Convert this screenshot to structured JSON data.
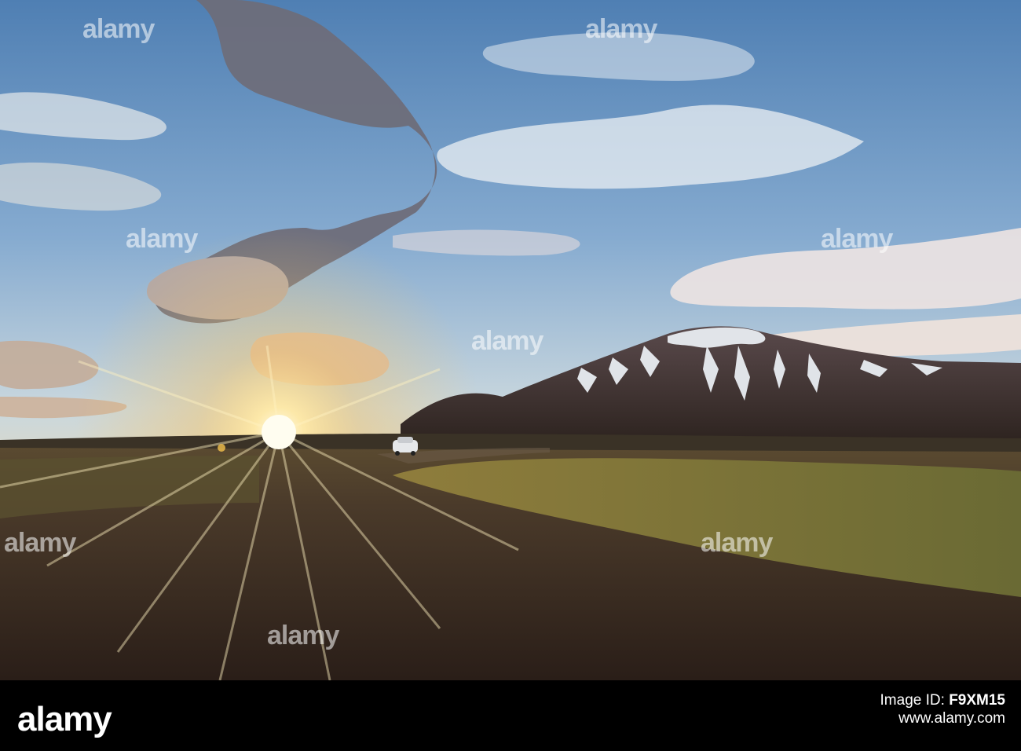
{
  "scene": {
    "description_tags": [
      "sunset",
      "snow-capped-mountain",
      "gravel-road",
      "car",
      "clouds",
      "lava-field"
    ]
  },
  "watermark": {
    "text": "alamy"
  },
  "footer": {
    "logo": "alamy",
    "image_id_label": "Image ID:",
    "image_id": "F9XM15",
    "url": "www.alamy.com"
  },
  "colors": {
    "sky_top": "#5c87b8",
    "sky_horizon": "#f4d9a8",
    "sun": "#fff6d0",
    "ground": "#3b2b22",
    "grass": "#7a6a35",
    "mountain": "#3a2d2a",
    "snow": "#e8ecf2"
  }
}
